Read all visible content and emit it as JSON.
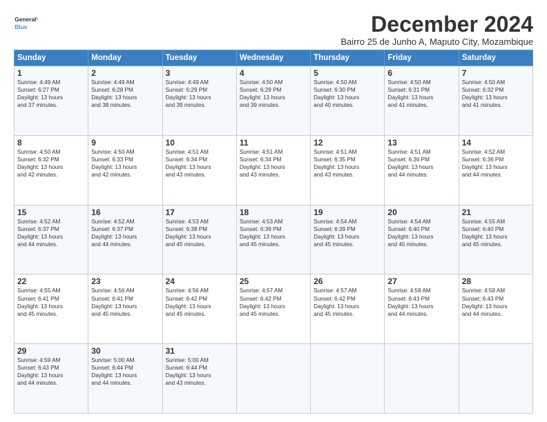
{
  "header": {
    "logo_line1": "General",
    "logo_line2": "Blue",
    "title": "December 2024",
    "subtitle": "Bairro 25 de Junho A, Maputo City, Mozambique"
  },
  "days_of_week": [
    "Sunday",
    "Monday",
    "Tuesday",
    "Wednesday",
    "Thursday",
    "Friday",
    "Saturday"
  ],
  "weeks": [
    [
      {
        "day": "1",
        "info": "Sunrise: 4:49 AM\nSunset: 6:27 PM\nDaylight: 13 hours\nand 37 minutes."
      },
      {
        "day": "2",
        "info": "Sunrise: 4:49 AM\nSunset: 6:28 PM\nDaylight: 13 hours\nand 38 minutes."
      },
      {
        "day": "3",
        "info": "Sunrise: 4:49 AM\nSunset: 6:29 PM\nDaylight: 13 hours\nand 39 minutes."
      },
      {
        "day": "4",
        "info": "Sunrise: 4:50 AM\nSunset: 6:29 PM\nDaylight: 13 hours\nand 39 minutes."
      },
      {
        "day": "5",
        "info": "Sunrise: 4:50 AM\nSunset: 6:30 PM\nDaylight: 13 hours\nand 40 minutes."
      },
      {
        "day": "6",
        "info": "Sunrise: 4:50 AM\nSunset: 6:31 PM\nDaylight: 13 hours\nand 41 minutes."
      },
      {
        "day": "7",
        "info": "Sunrise: 4:50 AM\nSunset: 6:32 PM\nDaylight: 13 hours\nand 41 minutes."
      }
    ],
    [
      {
        "day": "8",
        "info": "Sunrise: 4:50 AM\nSunset: 6:32 PM\nDaylight: 13 hours\nand 42 minutes."
      },
      {
        "day": "9",
        "info": "Sunrise: 4:50 AM\nSunset: 6:33 PM\nDaylight: 13 hours\nand 42 minutes."
      },
      {
        "day": "10",
        "info": "Sunrise: 4:51 AM\nSunset: 6:34 PM\nDaylight: 13 hours\nand 43 minutes."
      },
      {
        "day": "11",
        "info": "Sunrise: 4:51 AM\nSunset: 6:34 PM\nDaylight: 13 hours\nand 43 minutes."
      },
      {
        "day": "12",
        "info": "Sunrise: 4:51 AM\nSunset: 6:35 PM\nDaylight: 13 hours\nand 43 minutes."
      },
      {
        "day": "13",
        "info": "Sunrise: 4:51 AM\nSunset: 6:36 PM\nDaylight: 13 hours\nand 44 minutes."
      },
      {
        "day": "14",
        "info": "Sunrise: 4:52 AM\nSunset: 6:36 PM\nDaylight: 13 hours\nand 44 minutes."
      }
    ],
    [
      {
        "day": "15",
        "info": "Sunrise: 4:52 AM\nSunset: 6:37 PM\nDaylight: 13 hours\nand 44 minutes."
      },
      {
        "day": "16",
        "info": "Sunrise: 4:52 AM\nSunset: 6:37 PM\nDaylight: 13 hours\nand 44 minutes."
      },
      {
        "day": "17",
        "info": "Sunrise: 4:53 AM\nSunset: 6:38 PM\nDaylight: 13 hours\nand 45 minutes."
      },
      {
        "day": "18",
        "info": "Sunrise: 4:53 AM\nSunset: 6:39 PM\nDaylight: 13 hours\nand 45 minutes."
      },
      {
        "day": "19",
        "info": "Sunrise: 4:54 AM\nSunset: 6:39 PM\nDaylight: 13 hours\nand 45 minutes."
      },
      {
        "day": "20",
        "info": "Sunrise: 4:54 AM\nSunset: 6:40 PM\nDaylight: 13 hours\nand 45 minutes."
      },
      {
        "day": "21",
        "info": "Sunrise: 4:55 AM\nSunset: 6:40 PM\nDaylight: 13 hours\nand 45 minutes."
      }
    ],
    [
      {
        "day": "22",
        "info": "Sunrise: 4:55 AM\nSunset: 6:41 PM\nDaylight: 13 hours\nand 45 minutes."
      },
      {
        "day": "23",
        "info": "Sunrise: 4:56 AM\nSunset: 6:41 PM\nDaylight: 13 hours\nand 45 minutes."
      },
      {
        "day": "24",
        "info": "Sunrise: 4:56 AM\nSunset: 6:42 PM\nDaylight: 13 hours\nand 45 minutes."
      },
      {
        "day": "25",
        "info": "Sunrise: 4:57 AM\nSunset: 6:42 PM\nDaylight: 13 hours\nand 45 minutes."
      },
      {
        "day": "26",
        "info": "Sunrise: 4:57 AM\nSunset: 6:42 PM\nDaylight: 13 hours\nand 45 minutes."
      },
      {
        "day": "27",
        "info": "Sunrise: 4:58 AM\nSunset: 6:43 PM\nDaylight: 13 hours\nand 44 minutes."
      },
      {
        "day": "28",
        "info": "Sunrise: 4:58 AM\nSunset: 6:43 PM\nDaylight: 13 hours\nand 44 minutes."
      }
    ],
    [
      {
        "day": "29",
        "info": "Sunrise: 4:59 AM\nSunset: 6:43 PM\nDaylight: 13 hours\nand 44 minutes."
      },
      {
        "day": "30",
        "info": "Sunrise: 5:00 AM\nSunset: 6:44 PM\nDaylight: 13 hours\nand 44 minutes."
      },
      {
        "day": "31",
        "info": "Sunrise: 5:00 AM\nSunset: 6:44 PM\nDaylight: 13 hours\nand 43 minutes."
      },
      {
        "day": "",
        "info": ""
      },
      {
        "day": "",
        "info": ""
      },
      {
        "day": "",
        "info": ""
      },
      {
        "day": "",
        "info": ""
      }
    ]
  ]
}
